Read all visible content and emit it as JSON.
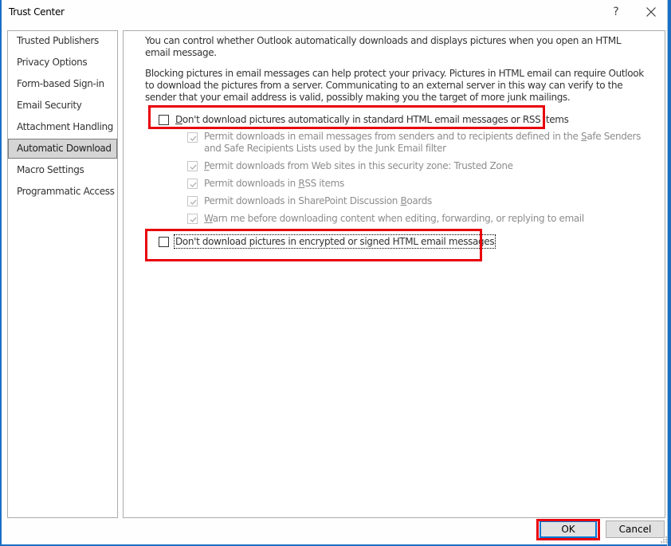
{
  "window": {
    "title": "Trust Center",
    "help_label": "?",
    "close_icon": "close-icon"
  },
  "sidebar": {
    "items": [
      {
        "label": "Trusted Publishers",
        "selected": false
      },
      {
        "label": "Privacy Options",
        "selected": false
      },
      {
        "label": "Form-based Sign-in",
        "selected": false
      },
      {
        "label": "Email Security",
        "selected": false
      },
      {
        "label": "Attachment Handling",
        "selected": false
      },
      {
        "label": "Automatic Download",
        "selected": true
      },
      {
        "label": "Macro Settings",
        "selected": false
      },
      {
        "label": "Programmatic Access",
        "selected": false
      }
    ]
  },
  "content": {
    "intro": "You can control whether Outlook automatically downloads and displays pictures when you open an HTML email message.",
    "privacy_note": "Blocking pictures in email messages can help protect your privacy. Pictures in HTML email can require Outlook to download the pictures from a server. Communicating to an external server in this way can verify to the sender that your email address is valid, possibly making you the target of more junk mailings.",
    "main_option": {
      "accel": "D",
      "label_rest": "on't download pictures automatically in standard HTML email messages or RSS items",
      "checked": false
    },
    "sub_options": [
      {
        "pre": "Permit downloads in email messages from senders and to recipients defined in the ",
        "accel": "S",
        "post": "afe Senders and Safe Recipients Lists used by the Junk Email filter",
        "checked": true,
        "enabled": false
      },
      {
        "pre": "",
        "accel": "P",
        "post": "ermit downloads from Web sites in this security zone: Trusted Zone",
        "checked": true,
        "enabled": false
      },
      {
        "pre": "Permit downloads in ",
        "accel": "R",
        "post": "SS items",
        "checked": true,
        "enabled": false
      },
      {
        "pre": "Permit downloads in SharePoint Discussion ",
        "accel": "B",
        "post": "oards",
        "checked": true,
        "enabled": false
      },
      {
        "pre": "",
        "accel": "W",
        "post": "arn me before downloading content when editing, forwarding, or replying to email",
        "checked": true,
        "enabled": false
      }
    ],
    "encrypted_option": {
      "label": "Don't download pictures in encrypted or signed HTML email messages",
      "checked": false,
      "focused": true
    }
  },
  "footer": {
    "ok_label": "OK",
    "cancel_label": "Cancel"
  },
  "colors": {
    "highlight": "#e8000b",
    "window_border": "#1a6fc4",
    "selected_nav_bg": "#d5d5d5",
    "disabled_text": "#8d8d8d"
  }
}
